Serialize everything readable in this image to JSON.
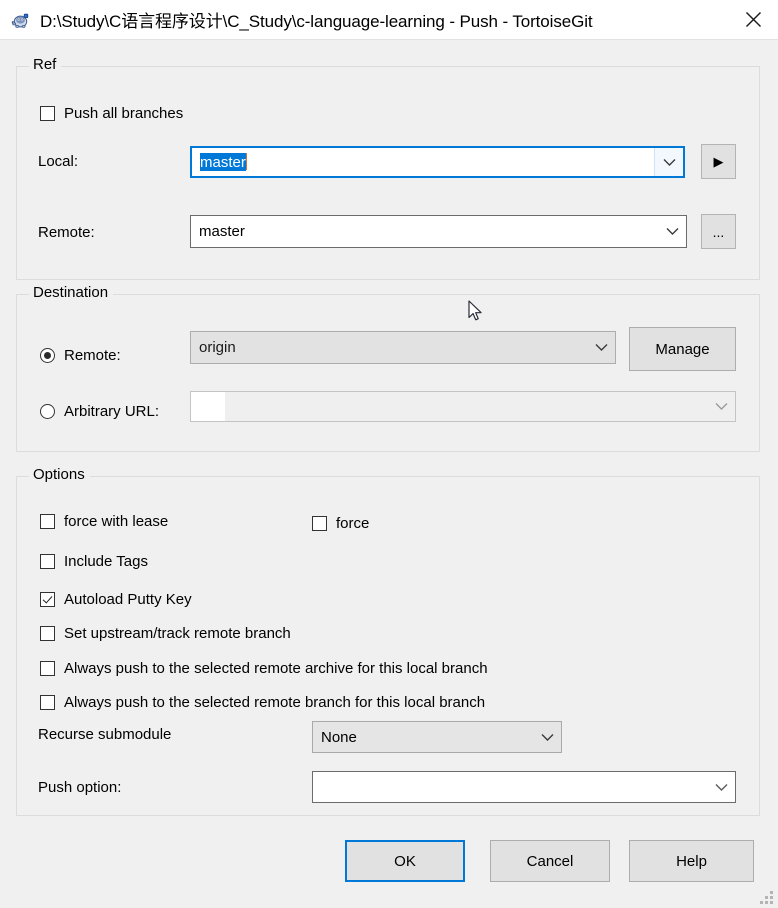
{
  "window": {
    "title": "D:\\Study\\C语言程序设计\\C_Study\\c-language-learning - Push - TortoiseGit",
    "icon": "tortoisegit-icon",
    "close_label": "✕",
    "accent_color": "#0078d7",
    "background_color": "#f0f0f0"
  },
  "ref_group": {
    "legend": "Ref",
    "push_all_branches": {
      "label": "Push all branches",
      "checked": false
    },
    "local": {
      "label": "Local:",
      "value": "master",
      "selected": true,
      "focused": true,
      "browse_button": "▶"
    },
    "remote": {
      "label": "Remote:",
      "value": "master",
      "browse_button": "..."
    }
  },
  "destination_group": {
    "legend": "Destination",
    "remote_radio": {
      "label": "Remote:",
      "selected": true,
      "value": "origin"
    },
    "arbitrary_url_radio": {
      "label": "Arbitrary URL:",
      "selected": false,
      "value": ""
    },
    "manage_button": "Manage"
  },
  "options_group": {
    "legend": "Options",
    "checkboxes": [
      {
        "label": "force with lease",
        "checked": false
      },
      {
        "label": "force",
        "checked": false
      },
      {
        "label": "Include Tags",
        "checked": false
      },
      {
        "label": "Autoload Putty Key",
        "checked": true
      },
      {
        "label": "Set upstream/track remote branch",
        "checked": false
      },
      {
        "label": "Always push to the selected remote archive for this local branch",
        "checked": false
      },
      {
        "label": "Always push to the selected remote branch for this local branch",
        "checked": false
      }
    ],
    "recurse_submodule": {
      "label": "Recurse submodule",
      "value": "None"
    },
    "push_option": {
      "label": "Push option:",
      "value": ""
    }
  },
  "footer": {
    "ok": "OK",
    "cancel": "Cancel",
    "help": "Help"
  }
}
